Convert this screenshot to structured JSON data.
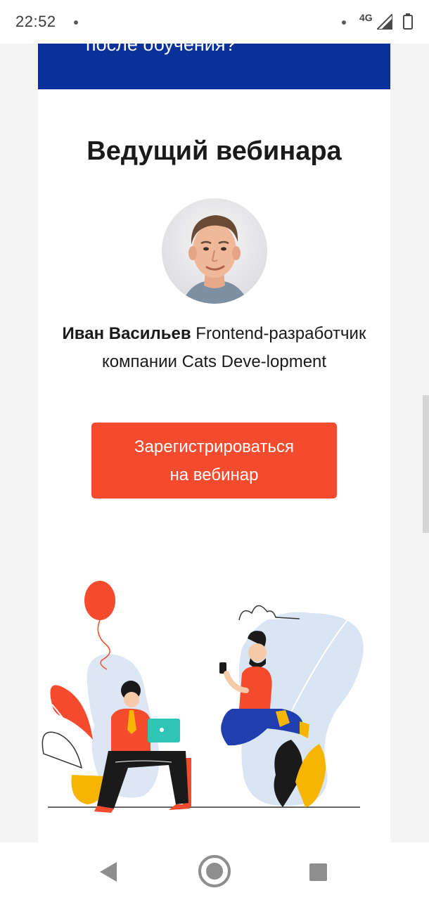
{
  "status_bar": {
    "time": "22:52",
    "network": "4G"
  },
  "banner": {
    "text": "после обучения?"
  },
  "host_section": {
    "title": "Ведущий вебинара",
    "host_name": "Иван Васильев",
    "host_description": " Frontend-разработчик компании Cats Deve-lopment"
  },
  "cta": {
    "line1": "Зарегистрироваться",
    "line2": "на вебинар"
  },
  "colors": {
    "banner_blue": "#0a3199",
    "cta_red": "#f44b2f"
  },
  "icons": {
    "back": "back-triangle-icon",
    "home": "home-circle-icon",
    "recent": "recent-apps-square-icon",
    "signal": "signal-icon",
    "battery": "battery-icon"
  }
}
